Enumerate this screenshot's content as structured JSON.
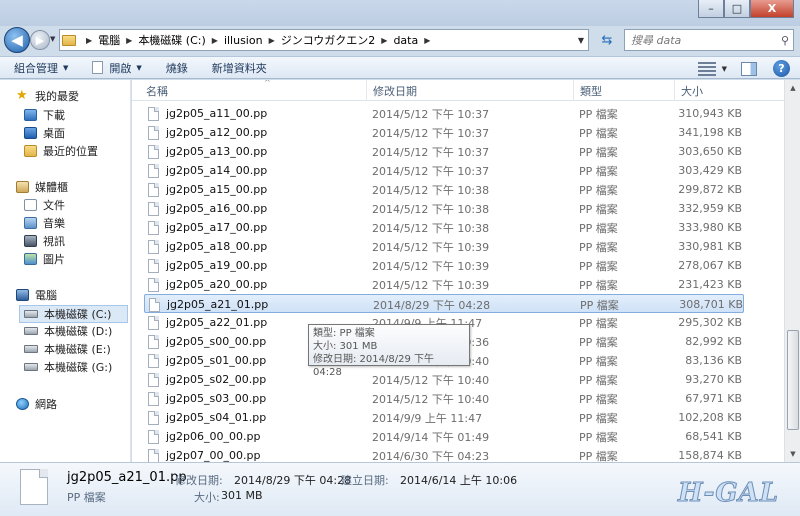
{
  "window": {
    "minimize": "–",
    "maximize": "□",
    "close": "X"
  },
  "address": {
    "crumbs": [
      "電腦",
      "本機磁碟 (C:)",
      "illusion",
      "ジンコウガクエン2",
      "data"
    ],
    "search_placeholder": "搜尋 data"
  },
  "toolbar": {
    "organize": "組合管理",
    "open": "開啟",
    "burn": "燒錄",
    "new_folder": "新增資料夾"
  },
  "nav": {
    "favorites": {
      "label": "我的最愛",
      "items": [
        "下載",
        "桌面",
        "最近的位置"
      ]
    },
    "libraries": {
      "label": "媒體櫃",
      "items": [
        "文件",
        "音樂",
        "視訊",
        "圖片"
      ]
    },
    "computer": {
      "label": "電腦",
      "items": [
        "本機磁碟 (C:)",
        "本機磁碟 (D:)",
        "本機磁碟 (E:)",
        "本機磁碟 (G:)"
      ]
    },
    "network": {
      "label": "網路"
    }
  },
  "columns": {
    "name": "名稱",
    "date": "修改日期",
    "type": "類型",
    "size": "大小"
  },
  "files": [
    {
      "name": "jg2p05_a11_00.pp",
      "date": "2014/5/12 下午 10:37",
      "type": "PP 檔案",
      "size": "310,943 KB"
    },
    {
      "name": "jg2p05_a12_00.pp",
      "date": "2014/5/12 下午 10:37",
      "type": "PP 檔案",
      "size": "341,198 KB"
    },
    {
      "name": "jg2p05_a13_00.pp",
      "date": "2014/5/12 下午 10:37",
      "type": "PP 檔案",
      "size": "303,650 KB"
    },
    {
      "name": "jg2p05_a14_00.pp",
      "date": "2014/5/12 下午 10:37",
      "type": "PP 檔案",
      "size": "303,429 KB"
    },
    {
      "name": "jg2p05_a15_00.pp",
      "date": "2014/5/12 下午 10:38",
      "type": "PP 檔案",
      "size": "299,872 KB"
    },
    {
      "name": "jg2p05_a16_00.pp",
      "date": "2014/5/12 下午 10:38",
      "type": "PP 檔案",
      "size": "332,959 KB"
    },
    {
      "name": "jg2p05_a17_00.pp",
      "date": "2014/5/12 下午 10:38",
      "type": "PP 檔案",
      "size": "333,980 KB"
    },
    {
      "name": "jg2p05_a18_00.pp",
      "date": "2014/5/12 下午 10:39",
      "type": "PP 檔案",
      "size": "330,981 KB"
    },
    {
      "name": "jg2p05_a19_00.pp",
      "date": "2014/5/12 下午 10:39",
      "type": "PP 檔案",
      "size": "278,067 KB"
    },
    {
      "name": "jg2p05_a20_00.pp",
      "date": "2014/5/12 下午 10:39",
      "type": "PP 檔案",
      "size": "231,423 KB"
    },
    {
      "name": "jg2p05_a21_01.pp",
      "date": "2014/8/29 下午 04:28",
      "type": "PP 檔案",
      "size": "308,701 KB",
      "selected": true
    },
    {
      "name": "jg2p05_a22_01.pp",
      "date": "2014/9/9 上午 11:47",
      "type": "PP 檔案",
      "size": "295,302 KB"
    },
    {
      "name": "jg2p05_s00_00.pp",
      "date": "2014/5/12 下午 10:36",
      "type": "PP 檔案",
      "size": "82,992 KB"
    },
    {
      "name": "jg2p05_s01_00.pp",
      "date": "2014/5/12 下午 10:40",
      "type": "PP 檔案",
      "size": "83,136 KB"
    },
    {
      "name": "jg2p05_s02_00.pp",
      "date": "2014/5/12 下午 10:40",
      "type": "PP 檔案",
      "size": "93,270 KB"
    },
    {
      "name": "jg2p05_s03_00.pp",
      "date": "2014/5/12 下午 10:40",
      "type": "PP 檔案",
      "size": "67,971 KB"
    },
    {
      "name": "jg2p05_s04_01.pp",
      "date": "2014/9/9 上午 11:47",
      "type": "PP 檔案",
      "size": "102,208 KB"
    },
    {
      "name": "jg2p06_00_00.pp",
      "date": "2014/9/14 下午 01:49",
      "type": "PP 檔案",
      "size": "68,541 KB"
    },
    {
      "name": "jg2p07_00_00.pp",
      "date": "2014/6/30 下午 04:23",
      "type": "PP 檔案",
      "size": "158,874 KB"
    }
  ],
  "tooltip": {
    "type": "類型: PP 檔案",
    "size": "大小: 301 MB",
    "modified": "修改日期: 2014/8/29 下午 04:28"
  },
  "details": {
    "filename": "jg2p05_a21_01.pp",
    "filetype": "PP 檔案",
    "modified_label": "修改日期:",
    "modified_value": "2014/8/29 下午 04:28",
    "created_label": "建立日期:",
    "created_value": "2014/6/14 上午 10:06",
    "size_label": "大小:",
    "size_value": "301 MB"
  },
  "watermark": "H-GAL",
  "colors": {
    "selection": "#cfe2f7",
    "selection_border": "#84acdd",
    "chrome": "#cfdcea"
  }
}
